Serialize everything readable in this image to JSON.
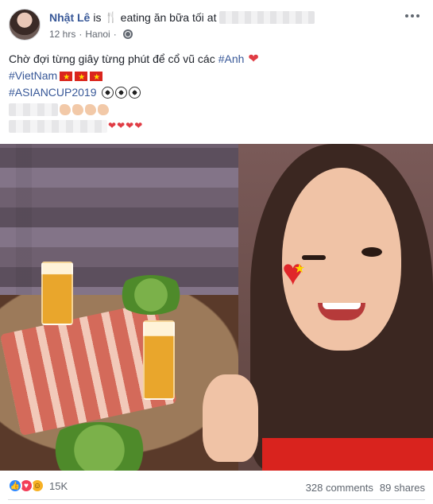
{
  "post": {
    "author": "Nhật Lê",
    "is_text": "is",
    "activity": "eating ăn bữa tối",
    "at_text": "at",
    "time": "12 hrs",
    "location": "Hanoi",
    "privacy_icon": "globe-icon",
    "more_icon": "more-dots-icon"
  },
  "text": {
    "line1": "Chờ đợi từng giây từng phút để cổ vũ các",
    "line1_hashtag": "#Anh",
    "line2_hashtag": "#VietNam",
    "line3_hashtag": "#ASIANCUP2019"
  },
  "footer": {
    "reaction_count": "15K",
    "comments": "328 comments",
    "shares": "89 shares"
  },
  "colors": {
    "link": "#385898",
    "text": "#1d2129",
    "meta": "#616770",
    "like": "#2d88ff",
    "love": "#f33e58",
    "haha": "#f7b125"
  }
}
